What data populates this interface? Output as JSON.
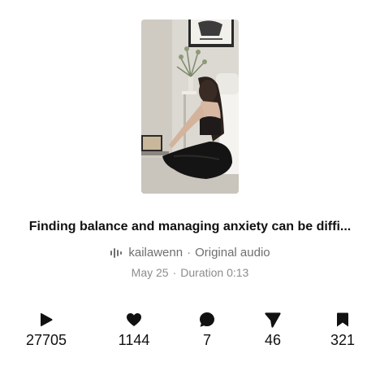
{
  "post": {
    "title": "Finding balance and managing anxiety can be diffi...",
    "audio": {
      "icon": "audio-wave-icon",
      "author": "kailawenn",
      "separator": "·",
      "label": "Original audio"
    },
    "meta": {
      "date": "May 25",
      "separator": "·",
      "duration": "Duration 0:13"
    }
  },
  "stats": {
    "plays": {
      "icon": "play-icon",
      "value": "27705"
    },
    "likes": {
      "icon": "heart-icon",
      "value": "1144"
    },
    "comments": {
      "icon": "comment-bubble-icon",
      "value": "7"
    },
    "shares": {
      "icon": "send-icon",
      "value": "46"
    },
    "saves": {
      "icon": "bookmark-icon",
      "value": "321"
    }
  },
  "colors": {
    "text_primary": "#111111",
    "text_secondary": "#6f6f6f",
    "text_tertiary": "#8c8c8c",
    "background": "#ffffff"
  }
}
